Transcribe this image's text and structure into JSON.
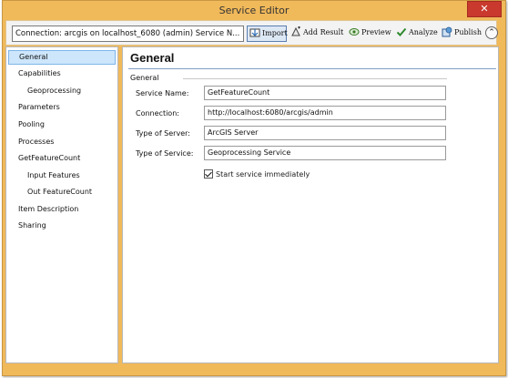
{
  "window": {
    "title": "Service Editor",
    "close_glyph": "✕"
  },
  "toolbar": {
    "connection": "Connection: arcgis on localhost_6080 (admin)   Service N...",
    "import_label": "Import",
    "add_result_label": "Add Result",
    "preview_label": "Preview",
    "analyze_label": "Analyze",
    "publish_label": "Publish",
    "collapse_glyph": "⌃"
  },
  "nav": {
    "items": [
      {
        "label": "General",
        "selected": true
      },
      {
        "label": "Capabilities"
      },
      {
        "label": "Geoprocessing",
        "sub": true
      },
      {
        "label": "Parameters"
      },
      {
        "label": "Pooling"
      },
      {
        "label": "Processes"
      },
      {
        "label": "GetFeatureCount"
      },
      {
        "label": "Input Features",
        "sub": true
      },
      {
        "label": "Out FeatureCount",
        "sub": true
      },
      {
        "label": "Item Description"
      },
      {
        "label": "Sharing"
      }
    ]
  },
  "general": {
    "title": "General",
    "group_label": "General",
    "service_name_label": "Service Name:",
    "service_name_value": "GetFeatureCount",
    "connection_label": "Connection:",
    "connection_value": "http://localhost:6080/arcgis/admin",
    "server_type_label": "Type of Server:",
    "server_type_value": "ArcGIS Server",
    "service_type_label": "Type of Service:",
    "service_type_value": "Geoprocessing Service",
    "start_checkbox_label": "Start service immediately",
    "start_checked": true
  },
  "colors": {
    "frame": "#f0b95a",
    "selection": "#cde6fb",
    "close": "#c9392d"
  }
}
